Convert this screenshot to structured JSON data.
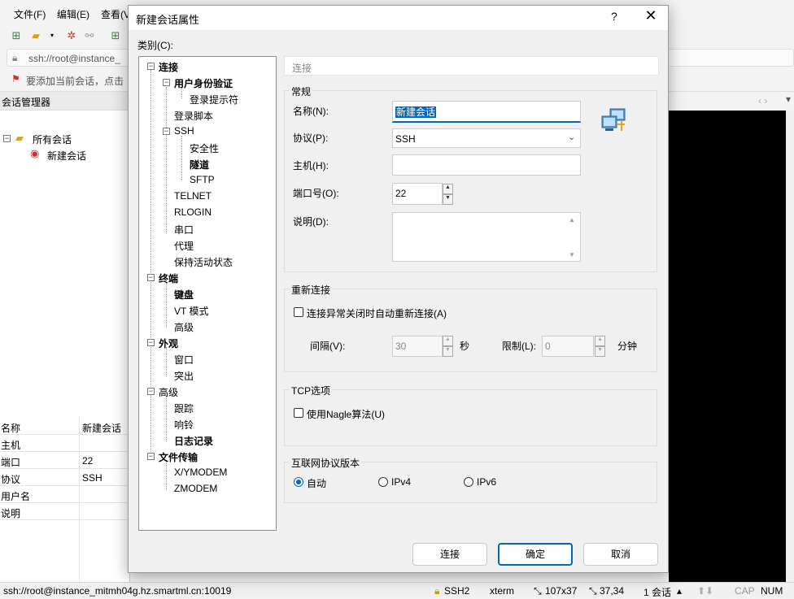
{
  "menu": [
    "文件(F)",
    "编辑(E)",
    "查看(V"
  ],
  "address": "ssh://root@instance_",
  "hint": "要添加当前会话，点击",
  "session_manager": {
    "title": "会话管理器",
    "tree": [
      "所有会话",
      "新建会话"
    ]
  },
  "properties": [
    {
      "k": "名称",
      "v": "新建会话"
    },
    {
      "k": "主机",
      "v": ""
    },
    {
      "k": "端口",
      "v": "22"
    },
    {
      "k": "协议",
      "v": "SSH"
    },
    {
      "k": "用户名",
      "v": ""
    },
    {
      "k": "说明",
      "v": ""
    }
  ],
  "status": {
    "host": "ssh://root@instance_mitmh04g.hz.smartml.cn:10019",
    "proto": "SSH2",
    "term": "xterm",
    "size": "107x37",
    "pos": "37,34",
    "sessions": "1 会话",
    "cap": "CAP",
    "num": "NUM"
  },
  "dialog": {
    "title": "新建会话属性",
    "help": "?",
    "close": "✕",
    "category_label": "类别(C):",
    "tree": {
      "connection": "连接",
      "auth": "用户身份验证",
      "login_prompt": "登录提示符",
      "login_script": "登录脚本",
      "ssh": "SSH",
      "security": "安全性",
      "tunnel": "隧道",
      "sftp": "SFTP",
      "telnet": "TELNET",
      "rlogin": "RLOGIN",
      "serial": "串口",
      "proxy": "代理",
      "keepalive": "保持活动状态",
      "terminal": "终端",
      "keyboard": "键盘",
      "vt_mode": "VT 模式",
      "advanced": "高级",
      "appearance": "外观",
      "window": "窗口",
      "highlight": "突出",
      "advanced2": "高级",
      "trace": "跟踪",
      "bell": "响铃",
      "logging": "日志记录",
      "file_transfer": "文件传输",
      "xymodem": "X/YMODEM",
      "zmodem": "ZMODEM"
    },
    "breadcrumb": "连接",
    "general": {
      "title": "常规",
      "name_label": "名称(N):",
      "name_value": "新建会话",
      "protocol_label": "协议(P):",
      "protocol_value": "SSH",
      "host_label": "主机(H):",
      "host_value": "",
      "port_label": "端口号(O):",
      "port_value": "22",
      "desc_label": "说明(D):"
    },
    "reconnect": {
      "title": "重新连接",
      "checkbox": "连接异常关闭时自动重新连接(A)",
      "interval_label": "间隔(V):",
      "interval_value": "30",
      "sec": "秒",
      "limit_label": "限制(L):",
      "limit_value": "0",
      "min": "分钟"
    },
    "tcp": {
      "title": "TCP选项",
      "checkbox": "使用Nagle算法(U)"
    },
    "ip": {
      "title": "互联网协议版本",
      "auto": "自动",
      "ipv4": "IPv4",
      "ipv6": "IPv6"
    },
    "buttons": {
      "connect": "连接",
      "ok": "确定",
      "cancel": "取消"
    }
  }
}
